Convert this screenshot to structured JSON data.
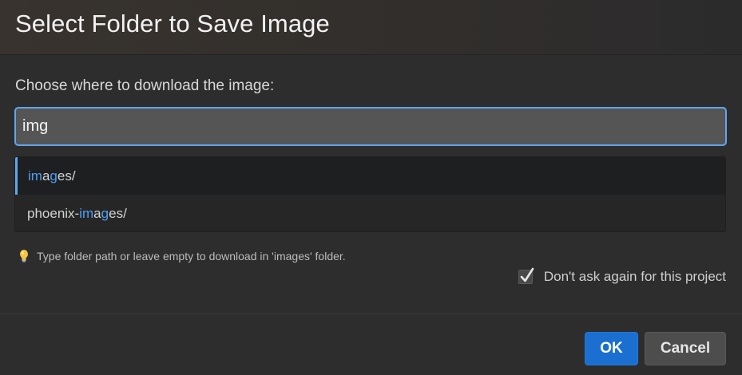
{
  "dialog": {
    "title": "Select Folder to Save Image",
    "prompt": "Choose where to download the image:"
  },
  "input": {
    "value": "img",
    "placeholder": ""
  },
  "suggestions": [
    {
      "selected": true,
      "parts": [
        {
          "text": "im",
          "match": true
        },
        {
          "text": "a",
          "match": false
        },
        {
          "text": "g",
          "match": true
        },
        {
          "text": "es/",
          "match": false
        }
      ]
    },
    {
      "selected": false,
      "parts": [
        {
          "text": "phoenix-",
          "match": false
        },
        {
          "text": "im",
          "match": true
        },
        {
          "text": "a",
          "match": false
        },
        {
          "text": "g",
          "match": true
        },
        {
          "text": "es/",
          "match": false
        }
      ]
    }
  ],
  "hint": {
    "icon": "lightbulb-icon",
    "text": "Type folder path or leave empty to download in 'images' folder."
  },
  "dont_ask": {
    "label": "Don't ask again for this project",
    "checked": true
  },
  "buttons": {
    "ok": "OK",
    "cancel": "Cancel"
  },
  "colors": {
    "accent": "#5fa6f0",
    "match_highlight": "#4f9ef6",
    "primary_button": "#1a6fd1"
  }
}
